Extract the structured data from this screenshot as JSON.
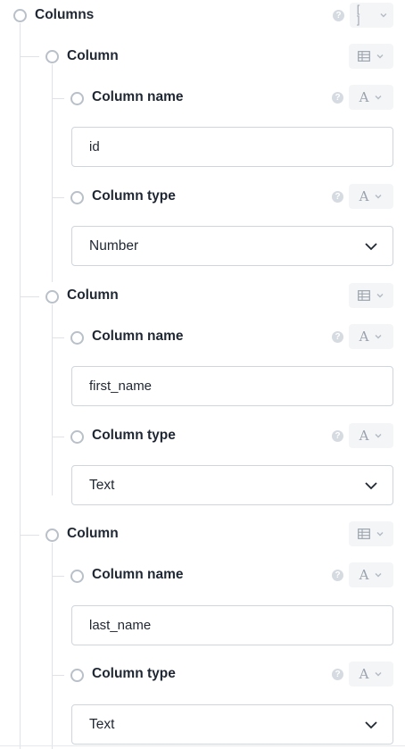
{
  "root": {
    "label": "Columns",
    "help_glyph": "?",
    "type_glyph": "[ ]"
  },
  "columns": [
    {
      "label": "Column",
      "name_field": {
        "label": "Column name",
        "value": "id",
        "help_glyph": "?",
        "type_glyph": "A"
      },
      "type_field": {
        "label": "Column type",
        "value": "Number",
        "help_glyph": "?",
        "type_glyph": "A"
      }
    },
    {
      "label": "Column",
      "name_field": {
        "label": "Column name",
        "value": "first_name",
        "help_glyph": "?",
        "type_glyph": "A"
      },
      "type_field": {
        "label": "Column type",
        "value": "Text",
        "help_glyph": "?",
        "type_glyph": "A"
      }
    },
    {
      "label": "Column",
      "name_field": {
        "label": "Column name",
        "value": "last_name",
        "help_glyph": "?",
        "type_glyph": "A"
      },
      "type_field": {
        "label": "Column type",
        "value": "Text",
        "help_glyph": "?",
        "type_glyph": "A"
      }
    }
  ],
  "colors": {
    "guide_line": "#dfe3e8",
    "node_circle": "#b9c0c9",
    "input_border": "#cfd5dc",
    "type_button_bg": "#f4f5f7",
    "text": "#1f2733"
  }
}
